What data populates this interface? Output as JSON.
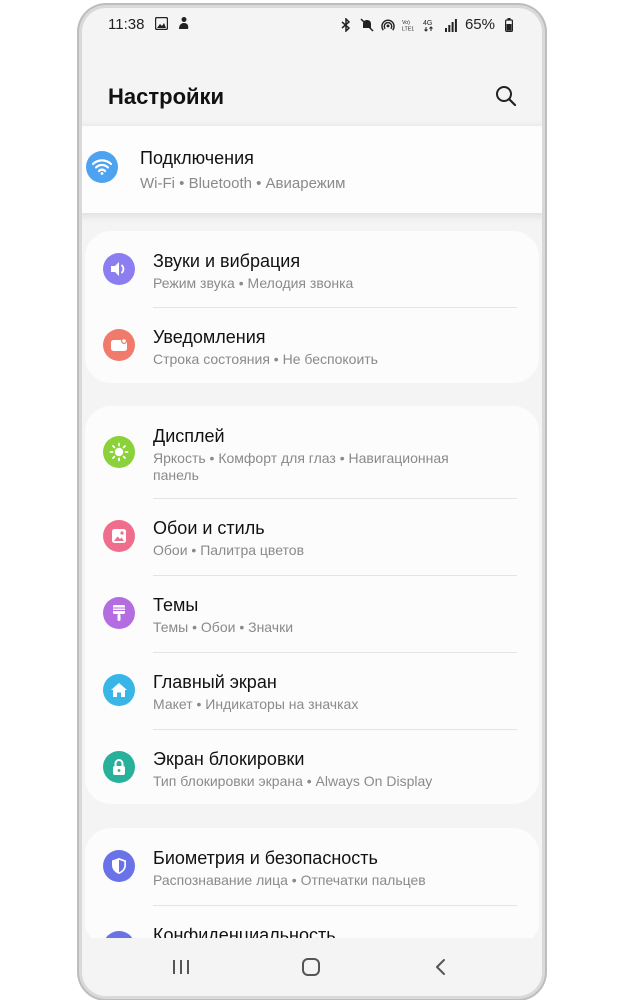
{
  "status_bar": {
    "time": "11:38",
    "battery": "65%",
    "left_icons": [
      "gallery-icon",
      "person-icon"
    ],
    "right_icons": [
      "bluetooth-icon",
      "mute-icon",
      "hotspot-icon",
      "volte-icon",
      "4g-icon",
      "signal-icon",
      "battery-icon"
    ]
  },
  "header": {
    "title": "Настройки"
  },
  "items": {
    "connections": {
      "title": "Подключения",
      "sub": "Wi-Fi  •  Bluetooth  •  Авиарежим",
      "color": "#4ea3f1"
    },
    "sounds": {
      "title": "Звуки и вибрация",
      "sub": "Режим звука  •  Мелодия звонка",
      "color": "#8c7ef0"
    },
    "notifications": {
      "title": "Уведомления",
      "sub": "Строка состояния  •  Не беспокоить",
      "color": "#f07a6c"
    },
    "display": {
      "title": "Дисплей",
      "sub1": "Яркость  •  Комфорт для глаз  •  Навигационная",
      "sub2": "панель",
      "color": "#8bd13a"
    },
    "wallpaper": {
      "title": "Обои и стиль",
      "sub": "Обои  •  Палитра цветов",
      "color": "#ef6d8d"
    },
    "themes": {
      "title": "Темы",
      "sub": "Темы  •  Обои  •  Значки",
      "color": "#b46de0"
    },
    "home": {
      "title": "Главный экран",
      "sub": "Макет  •  Индикаторы на значках",
      "color": "#38b6e8"
    },
    "lockscreen": {
      "title": "Экран блокировки",
      "sub": "Тип блокировки экрана  •  Always On Display",
      "color": "#28b09a"
    },
    "biometrics": {
      "title": "Биометрия и безопасность",
      "sub": "Распознавание лица  •  Отпечатки пальцев",
      "color": "#6a72e8"
    },
    "privacy": {
      "title": "Конфиденциальность",
      "color": "#6a72e8"
    }
  },
  "navbar": {
    "buttons": [
      "recents-button",
      "home-button",
      "back-button"
    ]
  }
}
